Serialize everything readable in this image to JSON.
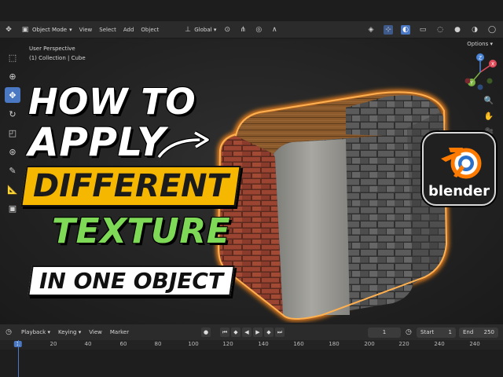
{
  "header": {
    "mode_label": "Object Mode",
    "menus": [
      "View",
      "Select",
      "Add",
      "Object"
    ],
    "transform_orientation": "Global"
  },
  "viewport": {
    "perspective_label": "User Perspective",
    "collection_label": "(1) Collection | Cube",
    "options_label": "Options"
  },
  "gizmo": {
    "x": "X",
    "y": "Y",
    "z": "Z"
  },
  "thumbnail": {
    "line1": "HOW TO",
    "line2": "APPLY",
    "line3": "DIFFERENT",
    "line4": "TEXTURE",
    "line5": "IN ONE OBJECT",
    "logo_text": "blender",
    "colors": {
      "yellow": "#f5b700",
      "green": "#7ed957",
      "orange": "#ff8a1c"
    }
  },
  "timeline": {
    "menus": [
      "Playback",
      "Keying",
      "View",
      "Marker"
    ],
    "current_frame": "1",
    "start_label": "Start",
    "start_value": "1",
    "end_label": "End",
    "end_value": "250",
    "ticks": [
      "1",
      "20",
      "40",
      "60",
      "80",
      "100",
      "120",
      "140",
      "160",
      "180",
      "200",
      "220",
      "240"
    ]
  }
}
